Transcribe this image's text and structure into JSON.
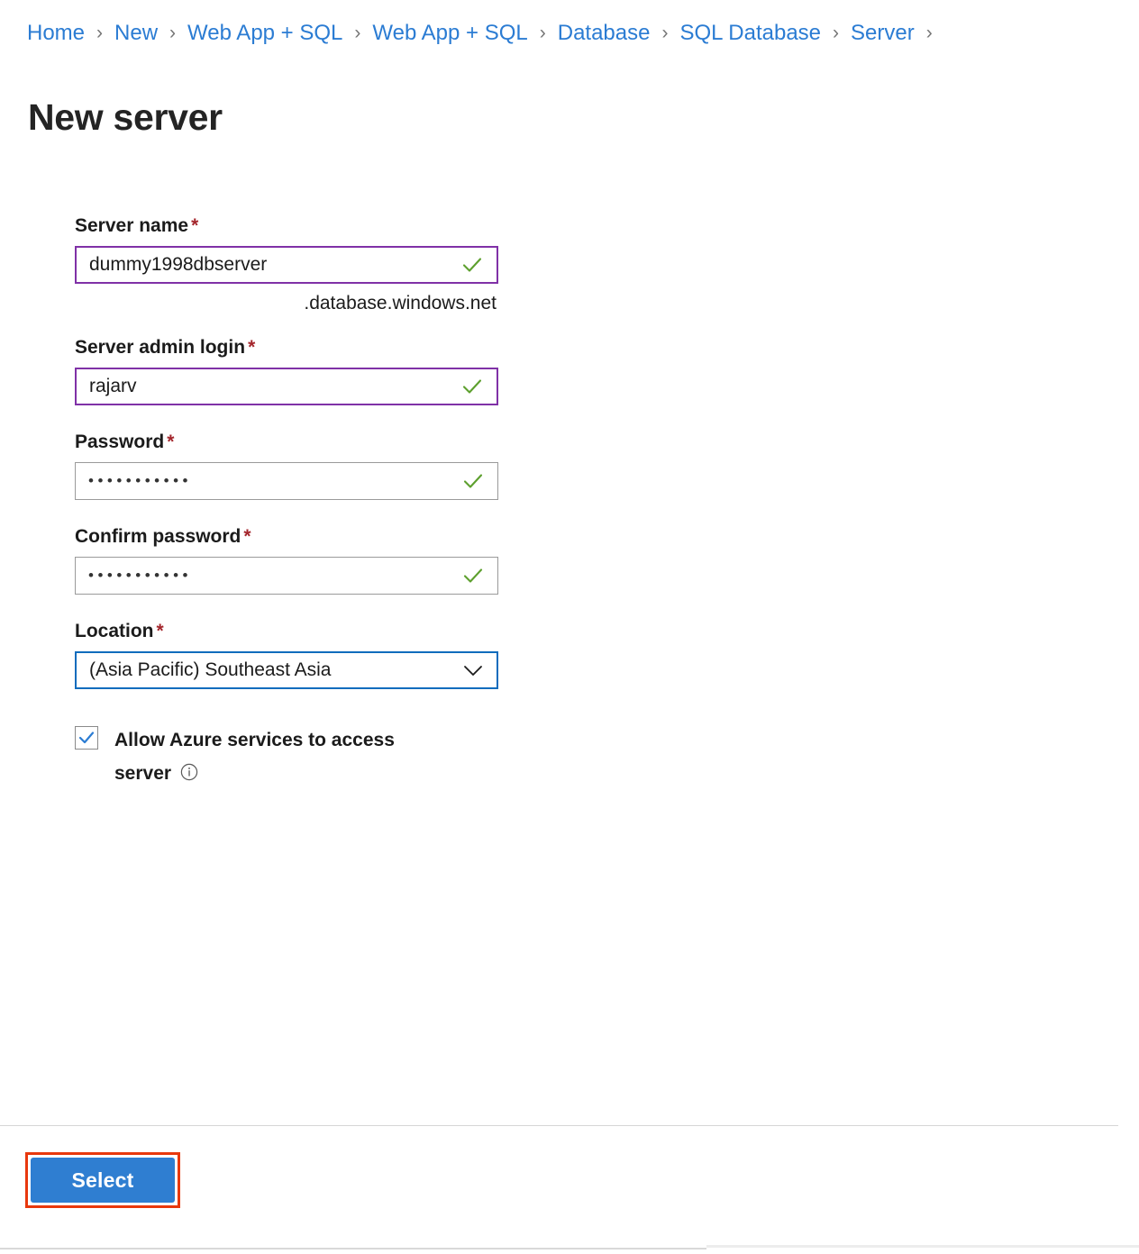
{
  "breadcrumb": {
    "items": [
      {
        "label": "Home"
      },
      {
        "label": "New"
      },
      {
        "label": "Web App + SQL"
      },
      {
        "label": "Web App + SQL"
      },
      {
        "label": "Database"
      },
      {
        "label": "SQL Database"
      },
      {
        "label": "Server"
      }
    ],
    "separator": "›",
    "trailing_separator": "›",
    "link_color": "#2b7cd3"
  },
  "page": {
    "title": "New server"
  },
  "form": {
    "required_marker": "*",
    "server_name": {
      "label": "Server name",
      "value": "dummy1998dbserver",
      "placeholder": "Server name",
      "suffix": ".database.windows.net",
      "validation_icon": "checkmark-icon",
      "border_color": "#8031a7"
    },
    "server_admin_login": {
      "label": "Server admin login",
      "value": "rajarv",
      "placeholder": "Server admin login",
      "validation_icon": "checkmark-icon",
      "border_color": "#8031a7"
    },
    "password": {
      "label": "Password",
      "value": "•••••••••••",
      "placeholder": "Password",
      "validation_icon": "checkmark-icon",
      "border_color": "#9a9a9a"
    },
    "confirm_password": {
      "label": "Confirm password",
      "value": "•••••••••••",
      "placeholder": "Confirm password",
      "validation_icon": "checkmark-icon",
      "border_color": "#9a9a9a"
    },
    "location": {
      "label": "Location",
      "selected": "(Asia Pacific) Southeast Asia",
      "dropdown_icon": "chevron-down-icon",
      "border_color": "#0f6cbd"
    },
    "allow_azure_services": {
      "label": "Allow Azure services to access server",
      "checked": true,
      "check_icon": "checkmark-icon",
      "info_icon": "info-icon",
      "check_color": "#2b7cd3"
    }
  },
  "footer": {
    "select_label": "Select",
    "button_color": "#2f7ed1",
    "highlight_color": "#e8380d"
  }
}
